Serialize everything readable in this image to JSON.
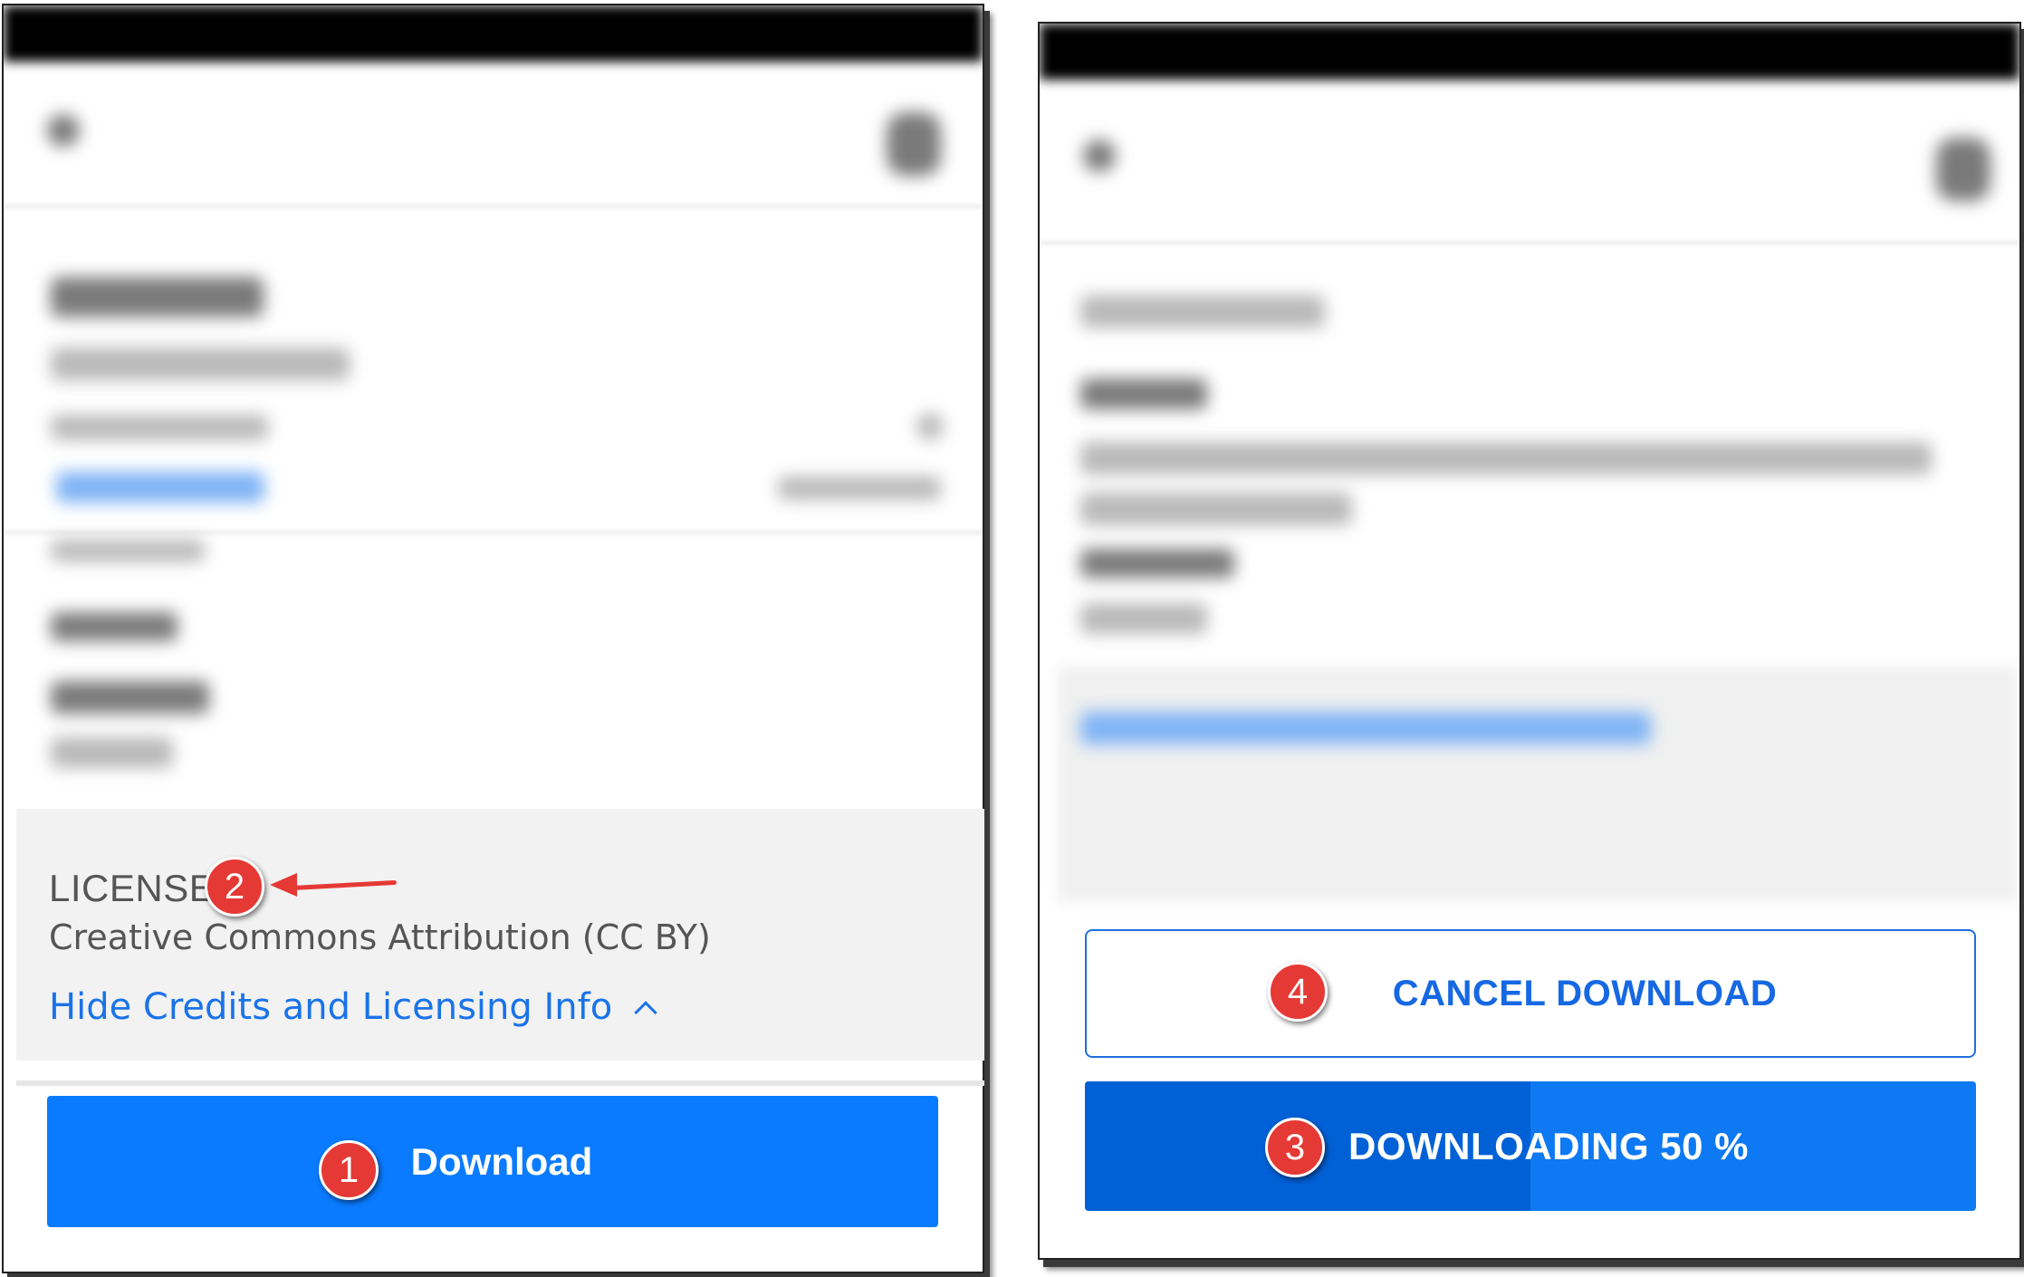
{
  "left_screen": {
    "license": {
      "heading": "LICENSE",
      "value": "Creative Commons Attribution (CC BY)",
      "toggle_link": "Hide Credits and Licensing Info"
    },
    "download_button": {
      "label": "Download"
    }
  },
  "right_screen": {
    "cancel_button": {
      "label": "CANCEL DOWNLOAD"
    },
    "progress_button": {
      "label": "DOWNLOADING 50 %",
      "progress_percent": 50
    }
  },
  "annotations": {
    "step_1": "1",
    "step_2": "2",
    "step_3": "3",
    "step_4": "4"
  },
  "colors": {
    "primary_blue": "#0a7bff",
    "progress_fill": "#0060d6",
    "link_blue": "#1a73e8",
    "badge_red": "#e53935",
    "panel_gray": "#f2f2f2"
  },
  "icons": [
    "back-arrow-icon",
    "share-icon",
    "chevron-up-icon",
    "expand-icon"
  ]
}
